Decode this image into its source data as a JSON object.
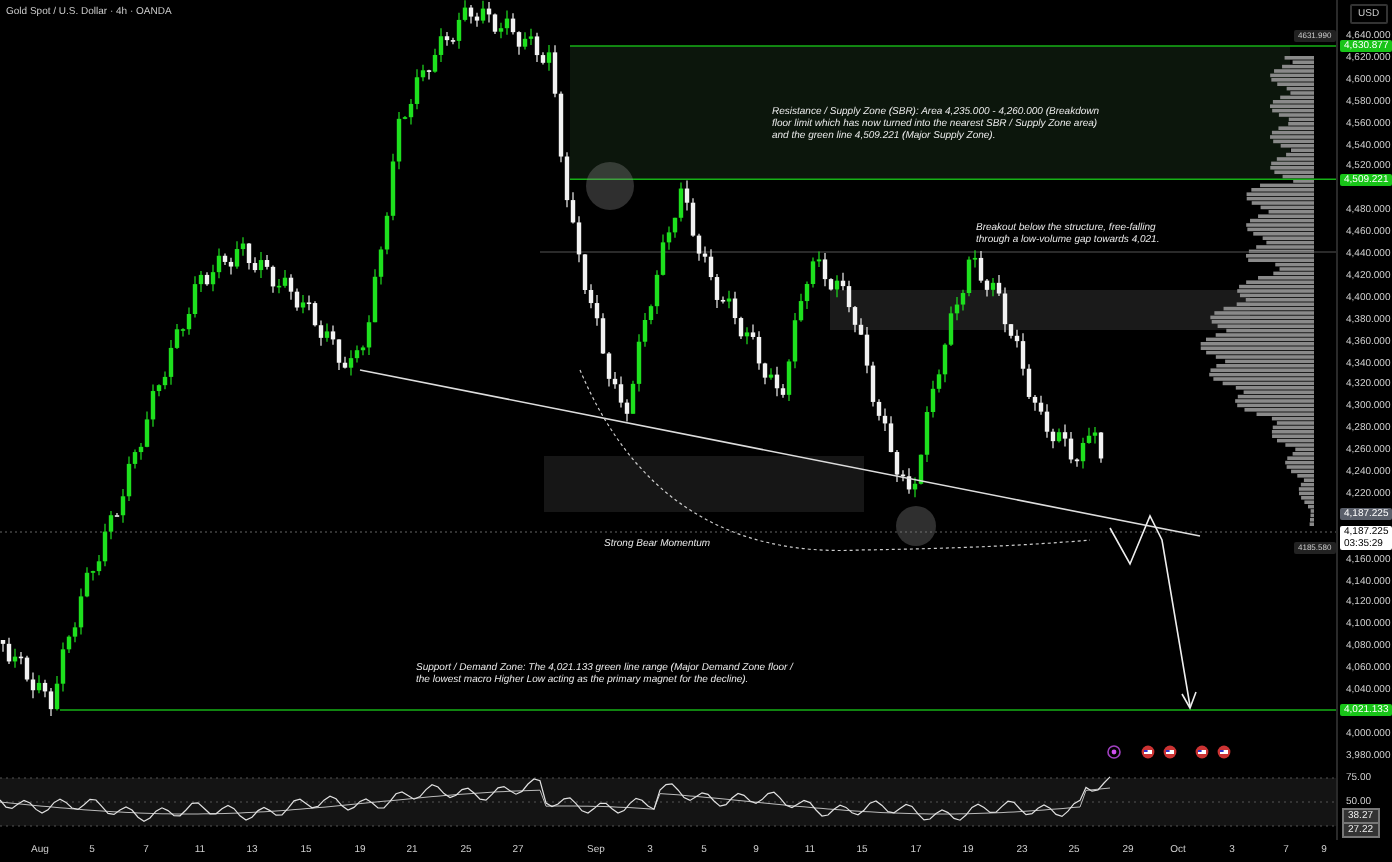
{
  "header": {
    "title": "Gold Spot / U.S. Dollar · 4h · OANDA"
  },
  "currency": "USD",
  "price_axis": {
    "labels": [
      "4,640.000",
      "4,620.000",
      "4,600.000",
      "4,580.000",
      "4,560.000",
      "4,540.000",
      "4,520.000",
      "4,480.000",
      "4,460.000",
      "4,440.000",
      "4,420.000",
      "4,400.000",
      "4,380.000",
      "4,360.000",
      "4,340.000",
      "4,320.000",
      "4,300.000",
      "4,280.000",
      "4,260.000",
      "4,240.000",
      "4,220.000",
      "4,160.000",
      "4,140.000",
      "4,120.000",
      "4,100.000",
      "4,080.000",
      "4,060.000",
      "4,040.000",
      "4,000.000",
      "3,980.000"
    ],
    "markers": [
      {
        "kind": "level",
        "text": "4,630.877"
      },
      {
        "kind": "level",
        "text": "4,509.221"
      },
      {
        "kind": "price",
        "text": "4,187.225"
      },
      {
        "kind": "last",
        "text": "4,187.225",
        "countdown": "03:35:29"
      },
      {
        "kind": "level",
        "text": "4,021.133"
      }
    ]
  },
  "profile_labels": [
    "4631.990",
    "4185.580"
  ],
  "annotations": [
    {
      "kind": "resistance",
      "text": "Resistance / Supply Zone (SBR): Area 4,235.000 - 4,260.000 (Breakdown floor limit which has now turned into the nearest SBR / Supply Zone area) and the green line 4,509.221 (Major Supply Zone)."
    },
    {
      "kind": "breakout",
      "text": "Breakout below the structure, free-falling through a low-volume gap towards 4,021."
    },
    {
      "kind": "momentum",
      "text": "Strong Bear Momentum"
    },
    {
      "kind": "support",
      "text": "Support / Demand Zone: The 4,021.133 green line range (Major Demand Zone floor / the lowest macro Higher Low acting as the primary magnet for the decline)."
    }
  ],
  "rsi_axis": {
    "labels": [
      "75.00",
      "50.00"
    ],
    "values": [
      "38.27",
      "27.22"
    ]
  },
  "time_axis": [
    "Aug",
    "5",
    "7",
    "11",
    "13",
    "15",
    "19",
    "21",
    "25",
    "27",
    "Sep",
    "3",
    "5",
    "9",
    "11",
    "15",
    "17",
    "19",
    "23",
    "25",
    "29",
    "Oct",
    "3",
    "7",
    "9"
  ]
}
